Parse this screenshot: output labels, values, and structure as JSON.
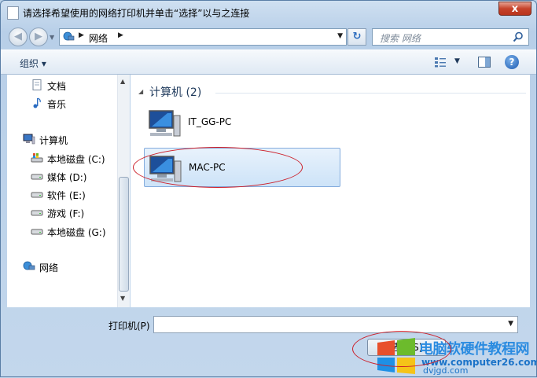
{
  "window": {
    "title": "请选择希望使用的网络打印机并单击“选择”以与之连接",
    "close_label": "x"
  },
  "navbar": {
    "address_segment": "网络",
    "search_placeholder": "搜索 网络"
  },
  "toolbar": {
    "organize_label": "组织 ▾"
  },
  "nav_pane": {
    "items": [
      {
        "label": "文档",
        "icon": "document-icon"
      },
      {
        "label": "音乐",
        "icon": "music-icon"
      },
      {
        "label": "计算机",
        "icon": "computer-icon"
      },
      {
        "label": "本地磁盘 (C:)",
        "icon": "system-drive-icon"
      },
      {
        "label": "媒体 (D:)",
        "icon": "drive-icon"
      },
      {
        "label": "软件 (E:)",
        "icon": "drive-icon"
      },
      {
        "label": "游戏 (F:)",
        "icon": "drive-icon"
      },
      {
        "label": "本地磁盘 (G:)",
        "icon": "drive-icon"
      },
      {
        "label": "网络",
        "icon": "network-icon"
      }
    ]
  },
  "content": {
    "group_header": "计算机 (2)",
    "computers": [
      {
        "name": "IT_GG-PC",
        "selected": false
      },
      {
        "name": "MAC-PC",
        "selected": true
      }
    ]
  },
  "footer": {
    "printer_label": "打印机(P)",
    "printer_value": "",
    "select_button": "选择(S)"
  },
  "watermark": {
    "title": "电脑软硬件教程网",
    "url": "www.computer26.com",
    "url2": "dvjgd.com"
  }
}
